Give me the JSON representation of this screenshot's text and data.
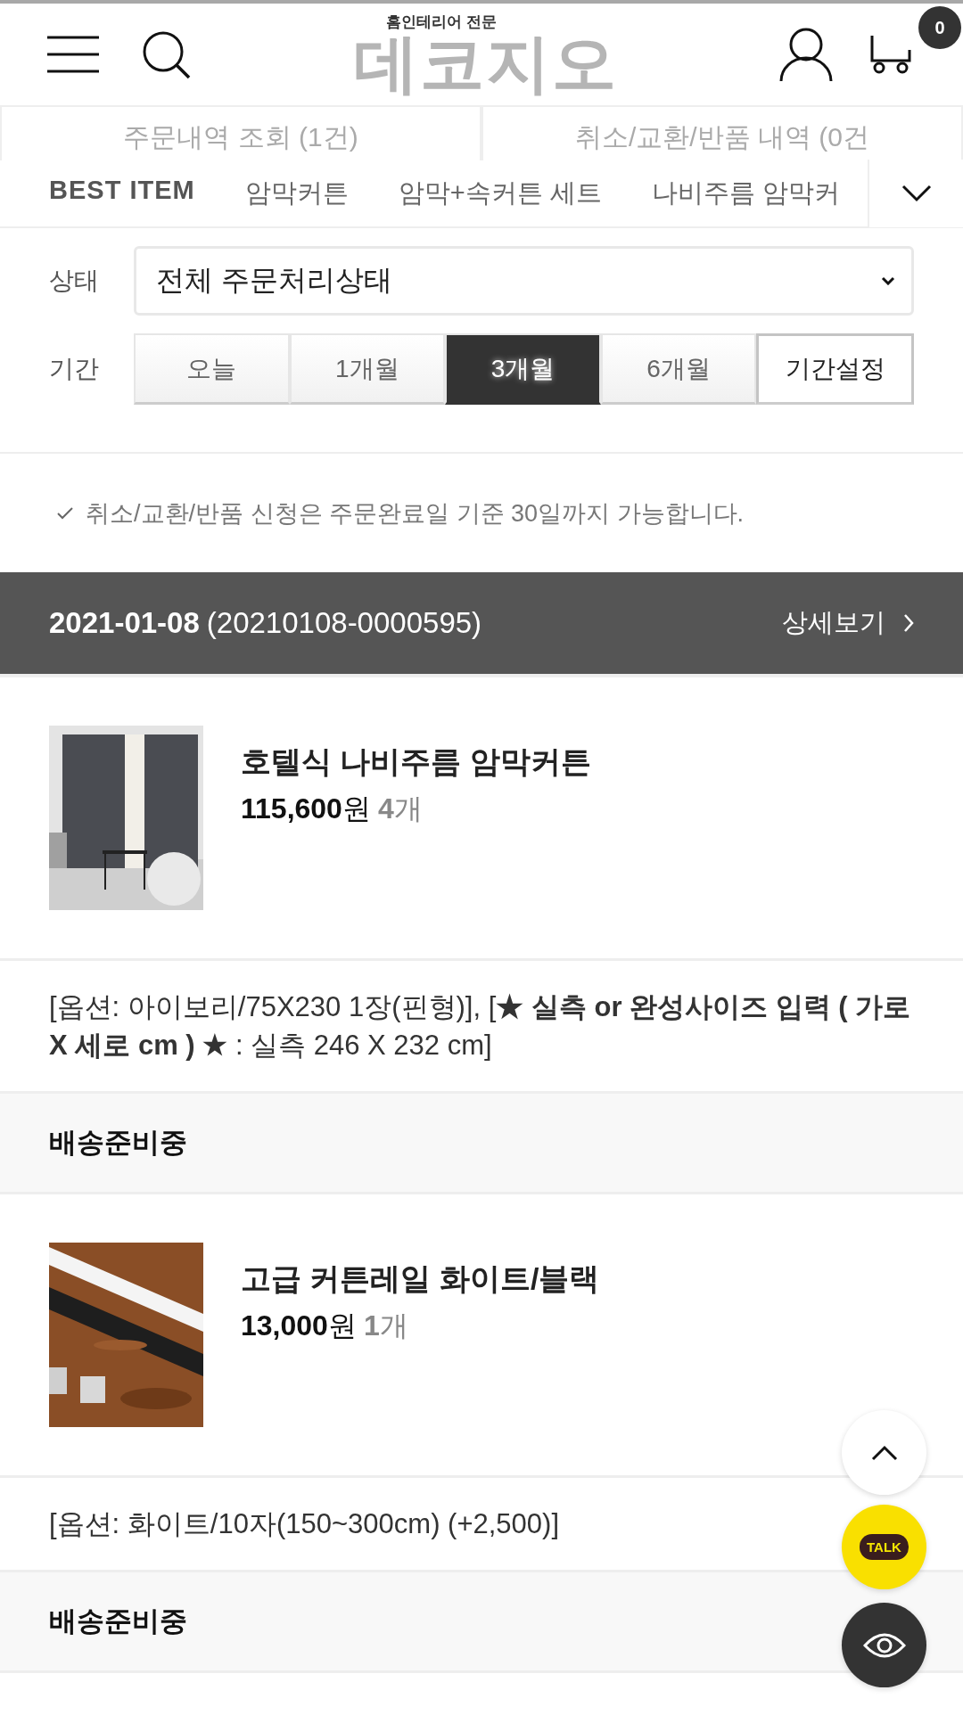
{
  "header": {
    "logo_tagline": "홈인테리어 전문",
    "logo": "데코지오",
    "cart_count": "0"
  },
  "order_tabs": [
    "주문내역 조회 (1건)",
    "취소/교환/반품 내역 (0건"
  ],
  "category_nav": [
    {
      "label": "BEST ITEM",
      "kind": "best"
    },
    {
      "label": "암막커튼",
      "kind": "category"
    },
    {
      "label": "암막+속커튼 세트",
      "kind": "category"
    },
    {
      "label": "나비주름 암막커",
      "kind": "category"
    }
  ],
  "filters": {
    "status_label": "상태",
    "status_value": "전체 주문처리상태",
    "period_label": "기간",
    "periods": [
      {
        "label": "오늘",
        "selected": false,
        "kind": "preset"
      },
      {
        "label": "1개월",
        "selected": false,
        "kind": "preset"
      },
      {
        "label": "3개월",
        "selected": true,
        "kind": "preset"
      },
      {
        "label": "6개월",
        "selected": false,
        "kind": "preset"
      },
      {
        "label": "기간설정",
        "selected": false,
        "kind": "custom"
      }
    ]
  },
  "notice": "취소/교환/반품 신청은 주문완료일 기준 30일까지 가능합니다.",
  "order": {
    "date": "2021-01-08",
    "number": "(20210108-0000595)",
    "detail_link": "상세보기",
    "items": [
      {
        "name": "호텔식 나비주름 암막커튼",
        "price": "115,600",
        "currency": "원",
        "quantity": "4",
        "unit": "개",
        "option": "[옵션: 아이보리/75X230 1장(핀형)], [**★ 실측 or 완성사이즈 입력 ( 가로 X 세로 cm ) ★** : 실측 246 X 232 cm]",
        "status": "배송준비중"
      },
      {
        "name": "고급 커튼레일 화이트/블랙",
        "price": "13,000",
        "currency": "원",
        "quantity": "1",
        "unit": "개",
        "option": "[옵션: 화이트/10자(150~300cm) (+2,500)]",
        "status": "배송준비중"
      }
    ]
  },
  "talk_button": "TALK"
}
